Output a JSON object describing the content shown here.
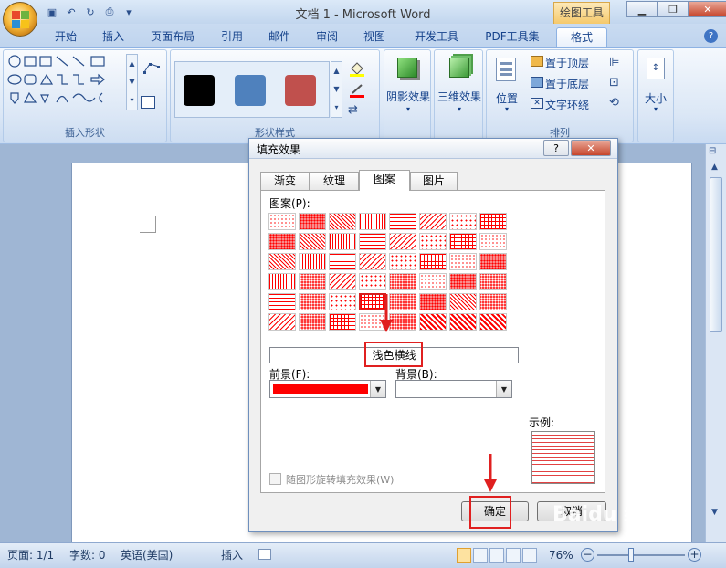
{
  "window": {
    "title": "文档 1 - Microsoft Word",
    "context_tab": "绘图工具"
  },
  "tabs": [
    "开始",
    "插入",
    "页面布局",
    "引用",
    "邮件",
    "审阅",
    "视图",
    "开发工具",
    "PDF工具集",
    "格式"
  ],
  "ribbon": {
    "groups": [
      "插入形状",
      "形状样式",
      "阴影效果",
      "三维效果",
      "排列",
      "大小"
    ],
    "big_buttons": {
      "shadow": "阴影效果",
      "three_d": "三维效果",
      "position": "位置",
      "size": "大小"
    },
    "arrange_items": [
      "置于顶层",
      "置于底层",
      "文字环绕"
    ],
    "style_colors": [
      "#000000",
      "#4f81bd",
      "#c0504d"
    ]
  },
  "dialog": {
    "title": "填充效果",
    "tabs": [
      "渐变",
      "纹理",
      "图案",
      "图片"
    ],
    "active_tab": "图案",
    "pattern_label": "图案(P):",
    "selected_pattern": "浅色横线",
    "foreground_label": "前景(F):",
    "background_label": "背景(B):",
    "foreground_color": "#ff0000",
    "sample_label": "示例:",
    "rotate_checkbox": "随图形旋转填充效果(W)",
    "ok": "确定",
    "cancel": "取消"
  },
  "statusbar": {
    "page": "页面: 1/1",
    "words": "字数: 0",
    "language": "英语(美国)",
    "mode": "插入",
    "zoom": "76%"
  },
  "watermark": "Baidu 经验"
}
